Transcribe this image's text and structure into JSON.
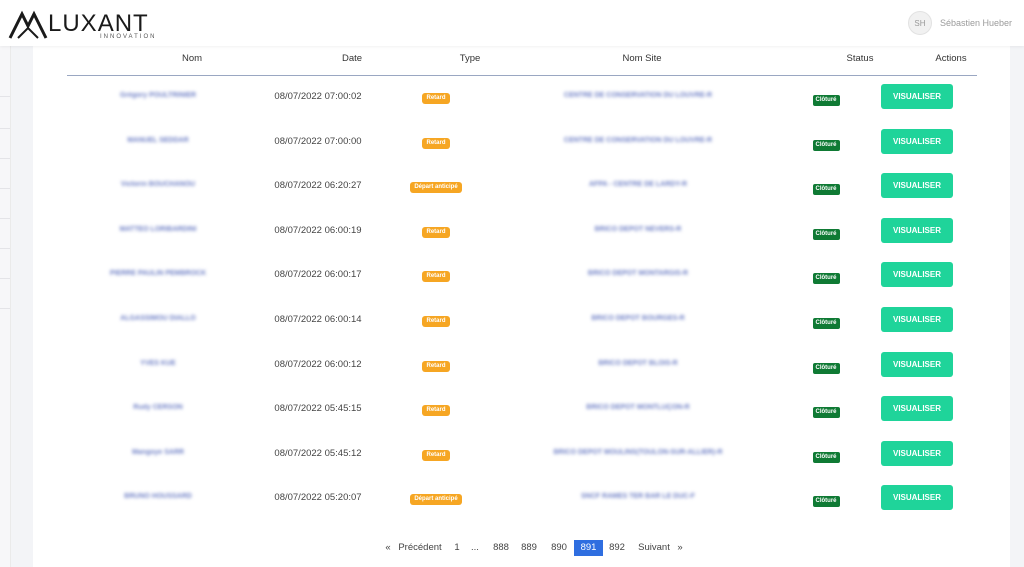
{
  "brand": {
    "name": "LUXANT",
    "tagline": "INNOVATION"
  },
  "user": {
    "initials": "SH",
    "name": "Sébastien Hueber"
  },
  "table": {
    "columns": [
      "Nom",
      "Date",
      "Type",
      "Nom Site",
      "Status",
      "Actions"
    ],
    "rows": [
      {
        "name": "Grégory POULTRINIER",
        "date": "08/07/2022 07:00:02",
        "type": "Retard",
        "site": "CENTRE DE CONSERVATION DU LOUVRE-R",
        "status": "Clôturé",
        "action": "VISUALISER"
      },
      {
        "name": "MANUEL SEDDAR",
        "date": "08/07/2022 07:00:00",
        "type": "Retard",
        "site": "CENTRE DE CONSERVATION DU LOUVRE-R",
        "status": "Clôturé",
        "action": "VISUALISER"
      },
      {
        "name": "Victorin BOUCHANOU",
        "date": "08/07/2022 06:20:27",
        "type": "Départ anticipé",
        "site": "AFPA - CENTRE DE LARDY-R",
        "status": "Clôturé",
        "action": "VISUALISER"
      },
      {
        "name": "MATTEO LORIBARDINI",
        "date": "08/07/2022 06:00:19",
        "type": "Retard",
        "site": "BRICO DEPOT NEVERS-R",
        "status": "Clôturé",
        "action": "VISUALISER"
      },
      {
        "name": "PIERRE PAULIN PEMBROCK",
        "date": "08/07/2022 06:00:17",
        "type": "Retard",
        "site": "BRICO DEPOT MONTARGIS-R",
        "status": "Clôturé",
        "action": "VISUALISER"
      },
      {
        "name": "ALGASSIMOU DIALLO",
        "date": "08/07/2022 06:00:14",
        "type": "Retard",
        "site": "BRICO DEPOT BOURGES-R",
        "status": "Clôturé",
        "action": "VISUALISER"
      },
      {
        "name": "YVES KUE",
        "date": "08/07/2022 06:00:12",
        "type": "Retard",
        "site": "BRICO DEPOT BLOIS-R",
        "status": "Clôturé",
        "action": "VISUALISER"
      },
      {
        "name": "Rudy CERSON",
        "date": "08/07/2022 05:45:15",
        "type": "Retard",
        "site": "BRICO DEPOT MONTLUÇON-R",
        "status": "Clôturé",
        "action": "VISUALISER"
      },
      {
        "name": "Mangoye SARR",
        "date": "08/07/2022 05:45:12",
        "type": "Retard",
        "site": "BRICO DEPOT MOULINS(TOULON-SUR-ALLIER)-R",
        "status": "Clôturé",
        "action": "VISUALISER"
      },
      {
        "name": "BRUNO HOUSSARD",
        "date": "08/07/2022 05:20:07",
        "type": "Départ anticipé",
        "site": "SNCF RAMES TER BAR LE DUC-F",
        "status": "Clôturé",
        "action": "VISUALISER"
      }
    ]
  },
  "pagination": {
    "items": [
      "«",
      "Précédent",
      "1",
      "...",
      "888",
      "889",
      "890",
      "891",
      "892",
      "Suivant",
      "»"
    ],
    "current": "891"
  },
  "colors": {
    "accent": "#1fd49a",
    "status": "#0f7a34",
    "badge": "#f6a623",
    "active_page": "#2f6ee0"
  }
}
